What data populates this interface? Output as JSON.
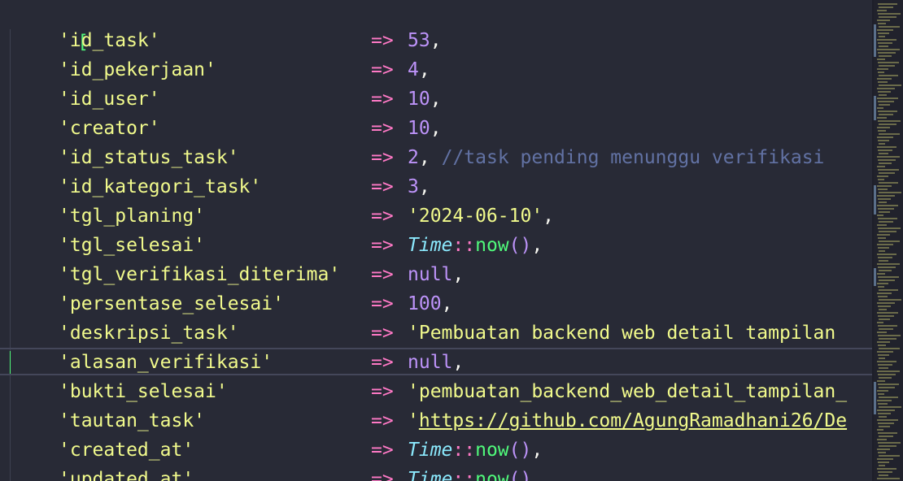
{
  "editor": {
    "open_bracket": "[",
    "lines": [
      {
        "key": "'id_task'",
        "value": "53",
        "tail": ","
      },
      {
        "key": "'id_pekerjaan'",
        "value": "4",
        "tail": ","
      },
      {
        "key": "'id_user'",
        "value": "10",
        "tail": ","
      },
      {
        "key": "'creator'",
        "value": "10",
        "tail": ","
      },
      {
        "key": "'id_status_task'",
        "value": "2",
        "tail": ",",
        "comment": "//task pending menunggu verifikasi"
      },
      {
        "key": "'id_kategori_task'",
        "value": "3",
        "tail": ","
      },
      {
        "key": "'tgl_planing'",
        "value": "'2024-06-10'",
        "tail": ","
      },
      {
        "key": "'tgl_selesai'",
        "class": "Time",
        "op": "::",
        "fn": "now",
        "paren": "()",
        "tail": ","
      },
      {
        "key": "'tgl_verifikasi_diterima'",
        "value": "null",
        "tail": ","
      },
      {
        "key": "'persentase_selesai'",
        "value": "100",
        "tail": ","
      },
      {
        "key": "'deskripsi_task'",
        "value": "'Pembuatan backend web detail tampilan"
      },
      {
        "key": "'alasan_verifikasi'",
        "value": "null",
        "tail": ","
      },
      {
        "key": "'bukti_selesai'",
        "value": "'pembuatan_backend_web_detail_tampilan_"
      },
      {
        "key": "'tautan_task'",
        "quote": "'",
        "link": "https://github.com/AgungRamadhani26/De"
      },
      {
        "key": "'created_at'",
        "class": "Time",
        "op": "::",
        "fn": "now",
        "paren": "()",
        "tail": ","
      },
      {
        "key": "'updated_at'",
        "class": "Time",
        "op": "::",
        "fn": "now",
        "paren": "()",
        "tail": ","
      }
    ],
    "arrow": "=>"
  }
}
